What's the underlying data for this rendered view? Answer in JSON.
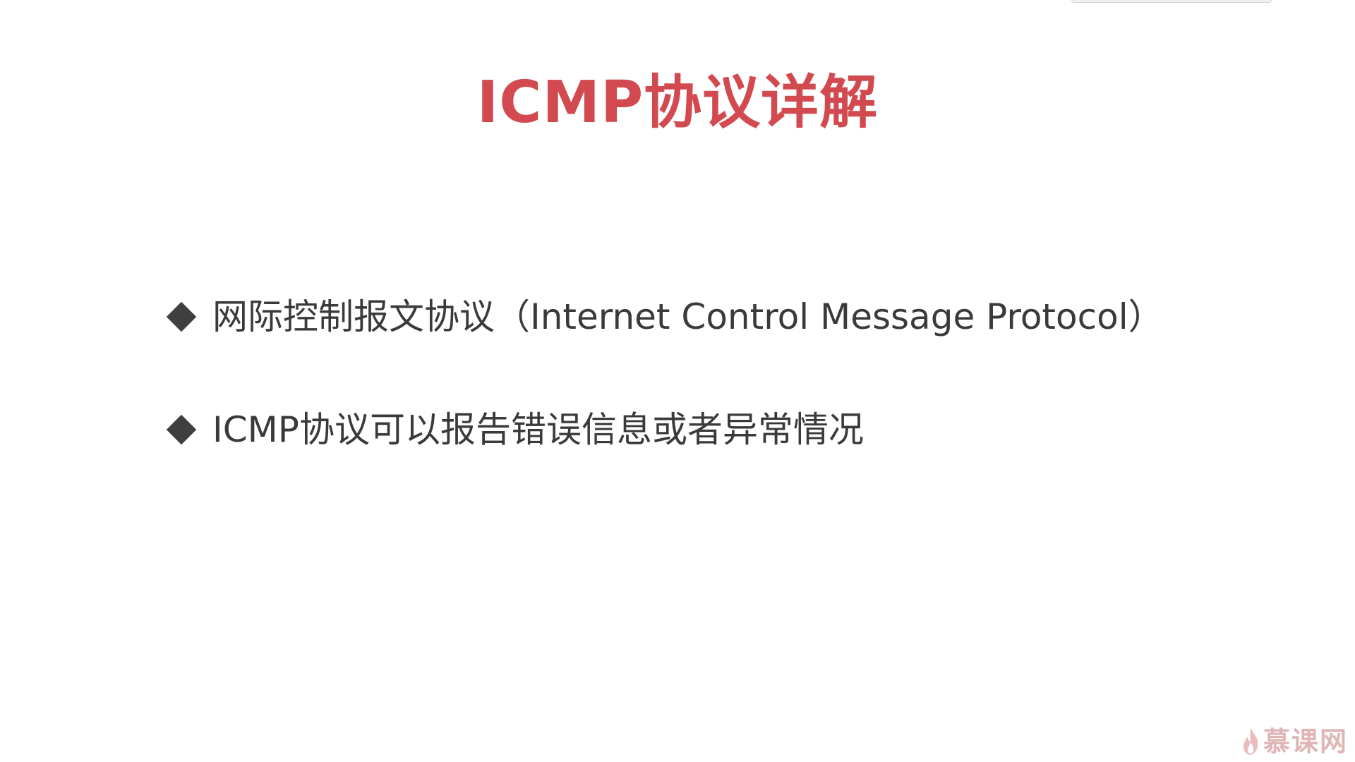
{
  "slide": {
    "title": "ICMP协议详解",
    "bullets": [
      {
        "text": "网际控制报文协议（Internet Control Message Protocol）"
      },
      {
        "text": "ICMP协议可以报告错误信息或者异常情况"
      }
    ],
    "watermark": {
      "text": "慕课网",
      "icon": "flame-icon"
    }
  },
  "colors": {
    "title": "#d24a4f",
    "body_text": "#3a3a3a",
    "bullet_marker": "#3f3f3f",
    "watermark": "#b04040",
    "background": "#ffffff"
  }
}
